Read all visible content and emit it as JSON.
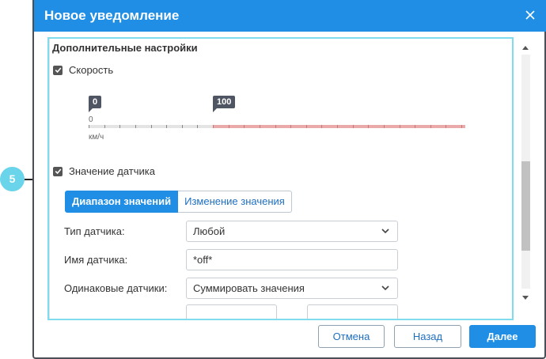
{
  "dialog": {
    "title": "Новое уведомление"
  },
  "section": {
    "title": "Дополнительные настройки"
  },
  "speed": {
    "label": "Скорость",
    "checked": true,
    "slider": {
      "min_label": "0",
      "max_label": "100",
      "scale_zero": "0",
      "unit": "км/ч"
    }
  },
  "sensor": {
    "label": "Значение датчика",
    "checked": true,
    "tabs": [
      {
        "label": "Диапазон значений",
        "active": true
      },
      {
        "label": "Изменение значения",
        "active": false
      }
    ],
    "type_label": "Тип датчика:",
    "type_value": "Любой",
    "name_label": "Имя датчика:",
    "name_value": "*off*",
    "same_label": "Одинаковые датчики:",
    "same_value": "Суммировать значения"
  },
  "callout": {
    "number": "5"
  },
  "footer": {
    "cancel": "Отмена",
    "back": "Назад",
    "next": "Далее"
  },
  "colors": {
    "accent": "#1f8ee4",
    "frame_highlight": "#7fdcef",
    "callout": "#6ad4ea",
    "range_active": "#eaaaaa"
  }
}
